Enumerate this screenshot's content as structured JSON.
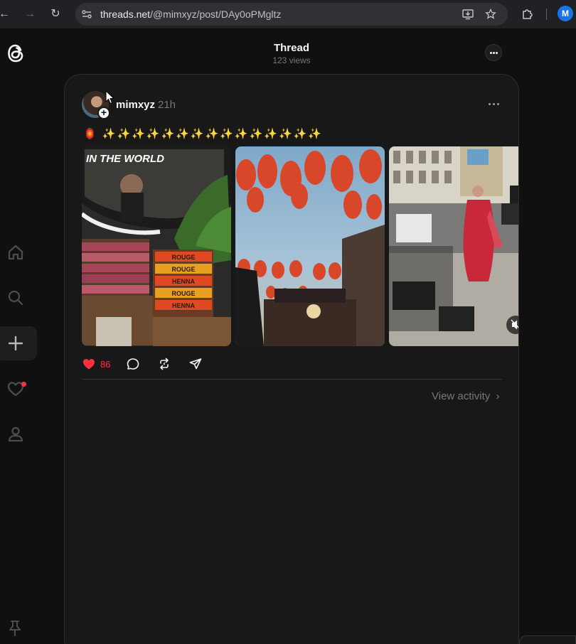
{
  "browser": {
    "url_domain": "threads.net",
    "url_path": "/@mimxyz/post/DAy0oPMgltz",
    "profile_initial": "M"
  },
  "header": {
    "title": "Thread",
    "views": "123 views"
  },
  "post": {
    "username": "mimxyz",
    "timestamp": "21h",
    "text": "🏮 ✨✨✨✨✨✨✨✨✨✨✨✨✨✨✨",
    "likes": "86",
    "media": [
      {
        "overlay_text": "IN THE WORLD",
        "book_labels": [
          "ROUGE",
          "ROUGE",
          "HENNA",
          "ROUGE",
          "HENNA"
        ]
      },
      {},
      {}
    ],
    "view_activity": "View activity"
  },
  "colors": {
    "background": "#101010",
    "card": "#181818",
    "like_red": "#ff3040",
    "muted_text": "#777777"
  },
  "icons": [
    "threads-logo-icon",
    "home-icon",
    "search-icon",
    "create-icon",
    "heart-icon",
    "profile-icon",
    "pin-icon",
    "comment-icon",
    "repost-icon",
    "share-icon",
    "more-icon",
    "mute-icon"
  ]
}
